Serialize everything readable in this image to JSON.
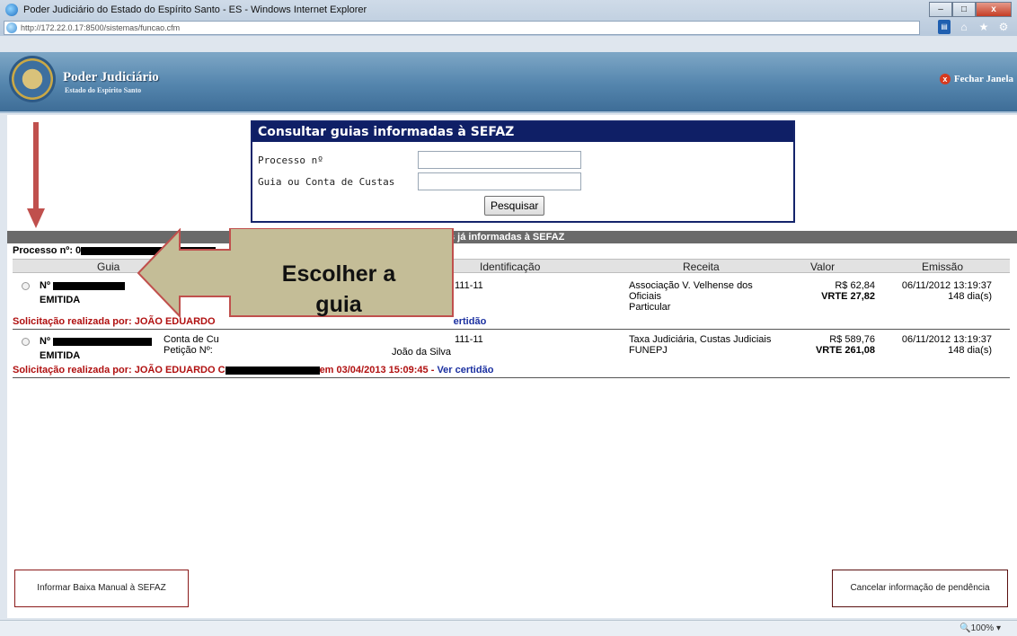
{
  "window": {
    "title": "Poder Judiciário do Estado do Espírito Santo - ES - Windows Internet Explorer",
    "url": "http://172.22.0.17:8500/sistemas/funcao.cfm",
    "minimize": "–",
    "maximize": "□",
    "close": "x"
  },
  "toolbar": {
    "feed": "▤",
    "home": "⌂",
    "favorites": "★",
    "tools": "⚙"
  },
  "header": {
    "brand_title": "Poder Judiciário",
    "brand_subtitle": "Estado do Espírito Santo",
    "close_window": "Fechar Janela",
    "close_icon": "x"
  },
  "search": {
    "title": "Consultar guias informadas à SEFAZ",
    "process_label": "Processo nº",
    "process_value": "",
    "guide_label": "Guia ou Conta de Custas",
    "guide_value": "",
    "button": "Pesquisar"
  },
  "section_title": "s já informadas à SEFAZ",
  "process_prefix": "Processo nº: 0",
  "table": {
    "headers": {
      "guia": "Guia",
      "identificacao": "Identificação",
      "receita": "Receita",
      "valor": "Valor",
      "emissao": "Emissão"
    },
    "rows": [
      {
        "numero": "Nº",
        "status": "EMITIDA",
        "ident": "111-11",
        "receita1": "Associação V. Velhense dos",
        "receita2": "Oficiais",
        "receita3": "Particular",
        "valor": "R$ 62,84",
        "vrte": "VRTE 27,82",
        "emissao": "06/11/2012 13:19:37",
        "dias": "148 dia(s)",
        "solic": "Solicitação realizada por: JOÃO EDUARDO",
        "link": "ertidão"
      },
      {
        "numero": "Nº",
        "status": "EMITIDA",
        "conta": "Conta de Cu",
        "peticao": "Petição Nº:",
        "ident": "111-11",
        "nome": "João da Silva",
        "receita1": "Taxa Judiciária, Custas Judiciais",
        "receita2": "FUNEPJ",
        "valor": "R$ 589,76",
        "vrte": "VRTE 261,08",
        "emissao": "06/11/2012 13:19:37",
        "dias": "148 dia(s)",
        "solic": "Solicitação realizada por: JOÃO EDUARDO C",
        "solic_date": "em 03/04/2013 15:09:45 - ",
        "link": "Ver certidão"
      }
    ]
  },
  "callout": {
    "line1": "Escolher a",
    "line2": "guia"
  },
  "buttons": {
    "informar": "Informar Baixa Manual à SEFAZ",
    "cancelar": "Cancelar informação de pendência"
  },
  "status": {
    "zoom": "🔍100%  ▾"
  },
  "colors": {
    "header_blue": "#4f80a8",
    "search_navy": "#0f1f66",
    "alert_red": "#b01010",
    "arrow_red": "#c0504d",
    "callout_fill": "#c4bd97"
  }
}
